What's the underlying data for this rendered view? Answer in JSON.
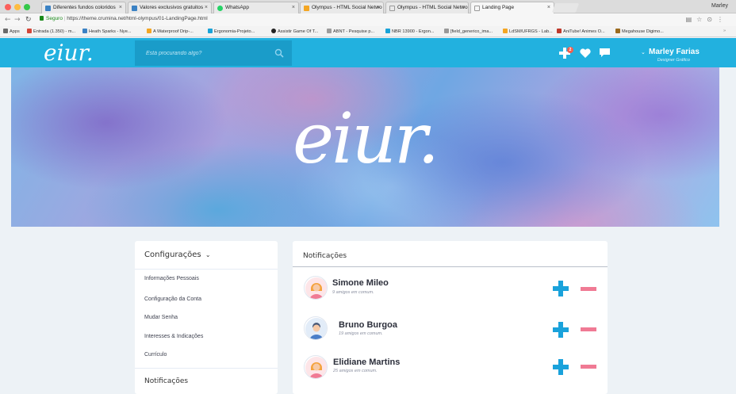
{
  "browser": {
    "window_user": "Marley",
    "tabs": [
      {
        "label": "Diferentes fundos coloridos",
        "color": "#3b82c4"
      },
      {
        "label": "Valores exclusivos gratuitos",
        "color": "#3b82c4"
      },
      {
        "label": "WhatsApp",
        "color": "#25d366"
      },
      {
        "label": "Olympus - HTML Social Netwo",
        "color": "#f4a623"
      },
      {
        "label": "Olympus - HTML Social Netwo",
        "color": "#999999"
      },
      {
        "label": "Landing Page",
        "color": "#999999"
      }
    ],
    "url_secure": "Seguro",
    "url": "https://theme.crumina.net/html-olympus/01-LandingPage.html",
    "bookmarks": [
      {
        "label": "Apps",
        "color": "#6a6a6a"
      },
      {
        "label": "Entrada (1.350) - m...",
        "color": "#d44638"
      },
      {
        "label": "Heath Sparks - Nye...",
        "color": "#3b82c4"
      },
      {
        "label": "A Waterproof Drip-...",
        "color": "#f4a623"
      },
      {
        "label": "Ergonomia-Projeto...",
        "color": "#1aa3d8"
      },
      {
        "label": "Assistir Game Of T...",
        "color": "#222222"
      },
      {
        "label": "ABNT - Pesquise p...",
        "color": "#9c9c9c"
      },
      {
        "label": "NBR 13900 - Ergon...",
        "color": "#1aa3d8"
      },
      {
        "label": "[field_generico_ima...",
        "color": "#999999"
      },
      {
        "label": "LdSM/UFRGS - Lab...",
        "color": "#f4a623"
      },
      {
        "label": "AniTube! Animes O...",
        "color": "#c0392b"
      },
      {
        "label": "Megahouse Digimo...",
        "color": "#9c6b1e"
      }
    ]
  },
  "header": {
    "logo": "eiur.",
    "search_placeholder": "Está procurando algo?",
    "notification_count": "2",
    "user_name": "Marley Farias",
    "user_role": "Designer Gráfico",
    "brand_color": "#22b1df"
  },
  "hero": {
    "logo": "eiur."
  },
  "settings": {
    "title": "Configurações",
    "items": [
      "Informações Pessoais",
      "Configuração da Conta",
      "Mudar Senha",
      "Interesses & Indicações",
      "Currículo"
    ],
    "notifications_section": "Notificações"
  },
  "notifications": {
    "title": "Notificações",
    "rows": [
      {
        "name": "Simone Mileo",
        "sub": "9 amigos em comum.",
        "avatar": "female"
      },
      {
        "name": "Bruno Burgoa",
        "sub": "19 amigos em comum.",
        "avatar": "male"
      },
      {
        "name": "Elidiane Martins",
        "sub": "25 amigos em comum.",
        "avatar": "female"
      }
    ],
    "accent_add": "#1aa2db",
    "accent_remove": "#f07a94"
  }
}
